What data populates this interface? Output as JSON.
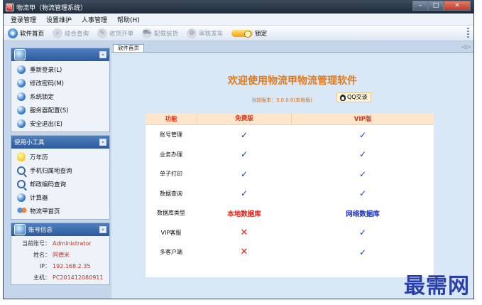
{
  "window": {
    "title": "物流甲（物流管理系统）",
    "controls": [
      "–",
      "□",
      "✕"
    ]
  },
  "menu": [
    "登录管理",
    "设置维护",
    "人事管理",
    "帮助(H)"
  ],
  "toolbar": {
    "items": [
      {
        "label": "软件首页",
        "icon": "home-globe-icon",
        "enabled": true
      },
      {
        "label": "综合查询",
        "icon": "search-icon",
        "enabled": false
      },
      {
        "label": "收货开单",
        "icon": "pen-icon",
        "enabled": false
      },
      {
        "label": "配载装货",
        "icon": "truck-icon",
        "enabled": false
      },
      {
        "label": "审核发车",
        "icon": "gear-icon",
        "enabled": false
      },
      {
        "label": "锁定",
        "icon": "lock-toggle-icon",
        "enabled": true
      }
    ]
  },
  "sidebar": {
    "system": {
      "title": "",
      "collapse": "«",
      "items": [
        {
          "label": "重新登录(L)"
        },
        {
          "label": "修改密码(M)"
        },
        {
          "label": "系统锁定"
        },
        {
          "label": "服务器配置(S)"
        },
        {
          "label": "安全退出(E)"
        }
      ]
    },
    "tools": {
      "title": "使用小工具",
      "collapse": "«",
      "items": [
        {
          "label": "万年历",
          "icon": "bulb-icon"
        },
        {
          "label": "手机归属地查询",
          "icon": "search-icon"
        },
        {
          "label": "邮政编码查询",
          "icon": "search-icon"
        },
        {
          "label": "计算器",
          "icon": "calculator-icon"
        },
        {
          "label": "物流甲首页",
          "icon": "users-icon"
        }
      ]
    },
    "account": {
      "title": "账号信息",
      "collapse": "«",
      "rows": [
        {
          "label": "当前账号：",
          "value": "Administrator"
        },
        {
          "label": "姓名：",
          "value": "同德米"
        },
        {
          "label": "IP：",
          "value": "192.168.2.35"
        },
        {
          "label": "主机：",
          "value": "PC201412080911"
        }
      ]
    }
  },
  "main": {
    "tab": "软件首页",
    "tab_arrows": "◁ ▷",
    "welcome": "欢迎使用物流甲物流管理软件",
    "version": "当前版本：3.0.0.0(本地版)",
    "qq_button": "QQ交谈",
    "table": {
      "headers": [
        "功能",
        "免费版",
        "VIP版"
      ],
      "rows": [
        {
          "feature": "账号管理",
          "free": "✓",
          "vip": "✓"
        },
        {
          "feature": "业务办理",
          "free": "✓",
          "vip": "✓"
        },
        {
          "feature": "单子打印",
          "free": "✓",
          "vip": "✓"
        },
        {
          "feature": "数据查询",
          "free": "✓",
          "vip": "✓"
        },
        {
          "feature": "数据库类型",
          "free": "本地数据库",
          "vip": "网络数据库"
        },
        {
          "feature": "VIP客服",
          "free": "✕",
          "vip": "✓"
        },
        {
          "feature": "多客户端",
          "free": "✕",
          "vip": "✓"
        }
      ]
    }
  },
  "watermark": "最需网",
  "colors": {
    "accent_orange": "#e07a1c",
    "header_blue": "#2c5a9c",
    "check_blue": "#1a3fb0",
    "cross_red": "#e0231a"
  }
}
